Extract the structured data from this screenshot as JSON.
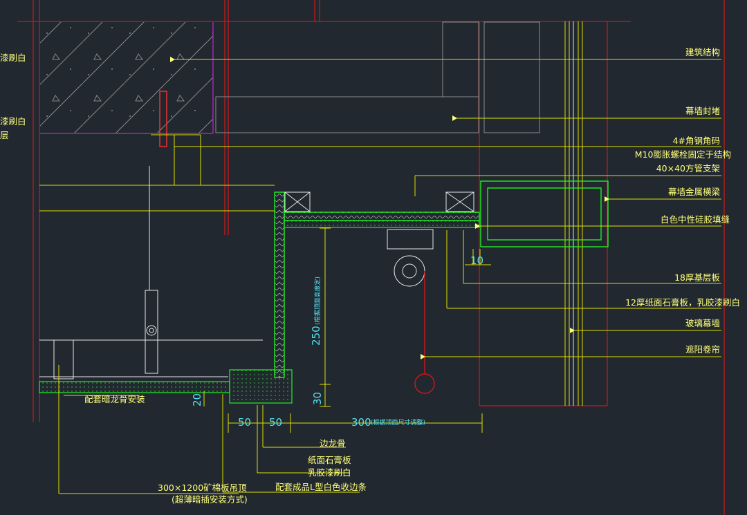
{
  "drawing": {
    "background": "#212830",
    "colors": {
      "label": "#ffff7a",
      "dimension": "#55e0f0",
      "structure": "#d01818",
      "finish": "#22ee22",
      "hatch": "#8a8a8a"
    }
  },
  "left_edge_fragments": [
    "漆刷白",
    "漆刷白",
    "层"
  ],
  "callouts": [
    {
      "text": "建筑结构"
    },
    {
      "text": "幕墙封堵"
    },
    {
      "text": "4#角钢角码"
    },
    {
      "text": "M10膨胀螺栓固定于结构"
    },
    {
      "text": "40×40方管支架"
    },
    {
      "text": "幕墙金属横梁"
    },
    {
      "text": "白色中性硅胶填缝"
    },
    {
      "text": "18厚基层板"
    },
    {
      "text": "12厚纸面石膏板，乳胶漆刷白"
    },
    {
      "text": "玻璃幕墙"
    },
    {
      "text": "遮阳卷帘"
    }
  ],
  "bottom_labels": {
    "keel": "配套暗龙骨安装",
    "side_keel": "边龙骨",
    "gypsum": "纸面石膏板",
    "paint": "乳胶漆刷白",
    "trim": "配套成品L型白色收边条",
    "ceiling": "300×1200矿棉板吊顶",
    "ceiling_note": "(超薄暗插安装方式)"
  },
  "dimensions": {
    "d250": "250",
    "d250_note": "(根据顶面高度定)",
    "d30": "30",
    "d20": "20",
    "d50a": "50",
    "d50b": "50",
    "d300": "300",
    "d300_note": "(根据顶面尺寸调整)",
    "d10": "10"
  }
}
